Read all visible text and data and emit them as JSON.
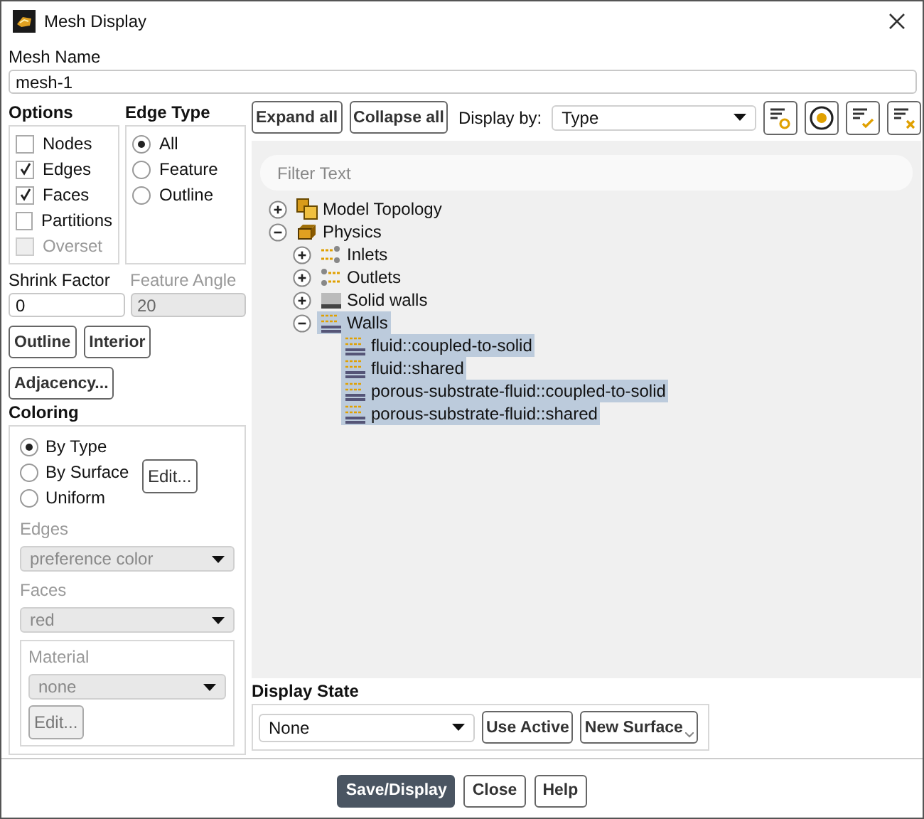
{
  "window": {
    "title": "Mesh Display"
  },
  "mesh_name": {
    "label": "Mesh Name",
    "value": "mesh-1"
  },
  "options": {
    "title": "Options",
    "items": [
      {
        "label": "Nodes",
        "checked": false,
        "disabled": false
      },
      {
        "label": "Edges",
        "checked": true,
        "disabled": false
      },
      {
        "label": "Faces",
        "checked": true,
        "disabled": false
      },
      {
        "label": "Partitions",
        "checked": false,
        "disabled": false
      },
      {
        "label": "Overset",
        "checked": false,
        "disabled": true
      }
    ]
  },
  "edge_type": {
    "title": "Edge Type",
    "items": [
      {
        "label": "All",
        "selected": true
      },
      {
        "label": "Feature",
        "selected": false
      },
      {
        "label": "Outline",
        "selected": false
      }
    ]
  },
  "shrink_factor": {
    "label": "Shrink Factor",
    "value": "0",
    "disabled": false
  },
  "feature_angle": {
    "label": "Feature Angle",
    "value": "20",
    "disabled": true
  },
  "left_buttons": [
    "Outline",
    "Interior",
    "Adjacency..."
  ],
  "coloring": {
    "title": "Coloring",
    "modes": [
      {
        "label": "By Type",
        "selected": true
      },
      {
        "label": "By Surface",
        "selected": false
      },
      {
        "label": "Uniform",
        "selected": false
      }
    ],
    "edit_button": "Edit...",
    "edges": {
      "label": "Edges",
      "value": "preference color",
      "disabled": true
    },
    "faces": {
      "label": "Faces",
      "value": "red",
      "disabled": true
    },
    "material": {
      "label": "Material",
      "value": "none",
      "disabled": true,
      "button": "Edit..."
    }
  },
  "toolbar": {
    "buttons": [
      "Expand all",
      "Collapse all"
    ],
    "display_by_label": "Display by:",
    "display_by": "Type"
  },
  "tree": {
    "filter_placeholder": "Filter Text",
    "items": [
      {
        "label": "Model Topology",
        "kind": "topology",
        "expanded": false,
        "selected": false
      },
      {
        "label": "Physics",
        "kind": "physics",
        "expanded": true,
        "selected": false,
        "children": [
          {
            "label": "Inlets",
            "kind": "inlet",
            "expanded": false,
            "selected": false
          },
          {
            "label": "Outlets",
            "kind": "outlet",
            "expanded": false,
            "selected": false
          },
          {
            "label": "Solid walls",
            "kind": "solid",
            "expanded": false,
            "selected": false
          },
          {
            "label": "Walls",
            "kind": "wall",
            "expanded": true,
            "selected": true,
            "children": [
              {
                "label": "fluid::coupled-to-solid",
                "kind": "wall",
                "selected": true
              },
              {
                "label": "fluid::shared",
                "kind": "wall",
                "selected": true
              },
              {
                "label": "porous-substrate-fluid::coupled-to-solid",
                "kind": "wall",
                "selected": true
              },
              {
                "label": "porous-substrate-fluid::shared",
                "kind": "wall",
                "selected": true
              }
            ]
          }
        ]
      }
    ]
  },
  "display_state": {
    "title": "Display State",
    "value": "None",
    "buttons": [
      "Use Active",
      "New Surface"
    ]
  },
  "footer_buttons": [
    {
      "label": "Save/Display",
      "primary": true
    },
    {
      "label": "Close",
      "primary": false
    },
    {
      "label": "Help",
      "primary": false
    }
  ]
}
